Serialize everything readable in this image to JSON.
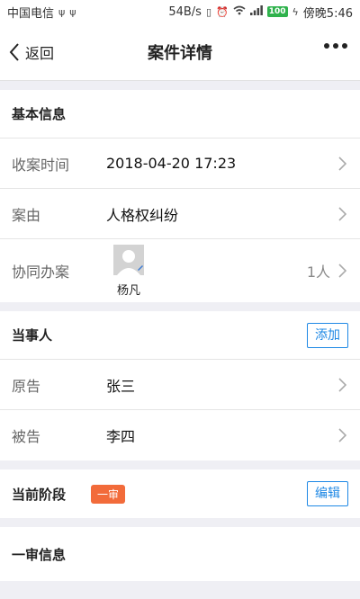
{
  "status_bar": {
    "carrier": "中国电信",
    "speed": "54B/s",
    "battery": "100",
    "time": "傍晚5:46"
  },
  "nav": {
    "back_label": "返回",
    "title": "案件详情"
  },
  "basic_info": {
    "header": "基本信息",
    "receive_time_label": "收案时间",
    "receive_time_value": "2018-04-20 17:23",
    "cause_label": "案由",
    "cause_value": "人格权纠纷",
    "collab_label": "协同办案",
    "collab_member_name": "杨凡",
    "collab_count": "1人"
  },
  "parties": {
    "header": "当事人",
    "add_label": "添加",
    "plaintiff_label": "原告",
    "plaintiff_value": "张三",
    "defendant_label": "被告",
    "defendant_value": "李四"
  },
  "stage": {
    "header": "当前阶段",
    "badge": "一审",
    "edit_label": "编辑"
  },
  "first_instance": {
    "header": "一审信息"
  },
  "colors": {
    "accent_blue": "#1e88e5",
    "stage_badge": "#f26b3a",
    "background": "#efeff4"
  }
}
